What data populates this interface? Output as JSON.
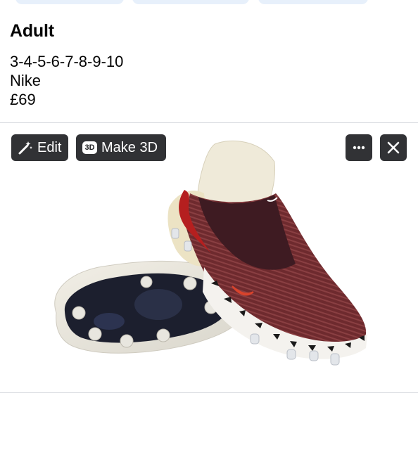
{
  "post": {
    "title": "Adult",
    "lines": [
      "3-4-5-6-7-8-9-10",
      "Nike",
      "£69"
    ]
  },
  "media": {
    "buttons": {
      "edit_label": "Edit",
      "make3d_label": "Make 3D",
      "make3d_badge": "3D"
    },
    "icons": {
      "edit": "magic-wand-icon",
      "more": "more-dots-icon",
      "close": "close-icon"
    },
    "image_alt": "Pair of dark red knit football boots with cream collars and animal-print soleplates"
  },
  "colors": {
    "button_bg": "#202124",
    "divider": "#dadde1",
    "pill": "#e7f0fb"
  }
}
